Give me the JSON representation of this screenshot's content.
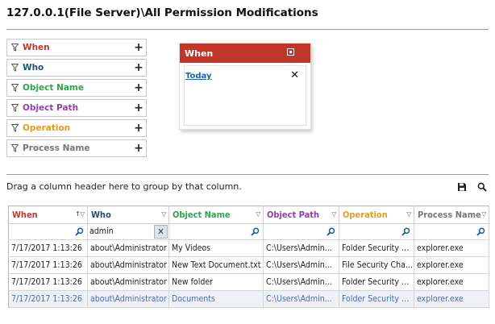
{
  "title": "127.0.0.1(File Server)\\All Permission Modifications",
  "filters": [
    {
      "label": "When",
      "color": "#c0372a"
    },
    {
      "label": "Who",
      "color": "#1f4e79"
    },
    {
      "label": "Object Name",
      "color": "#2ea44f"
    },
    {
      "label": "Object Path",
      "color": "#8e3fa8"
    },
    {
      "label": "Operation",
      "color": "#e39b1b"
    },
    {
      "label": "Process Name",
      "color": "#777777"
    }
  ],
  "panel": {
    "title": "When",
    "item": "Today"
  },
  "drag_hint": "Drag a column header here to group by that column.",
  "grid": {
    "columns": [
      {
        "label": "When",
        "color": "#c0372a"
      },
      {
        "label": "Who",
        "color": "#1f4e79"
      },
      {
        "label": "Object Name",
        "color": "#2ea44f"
      },
      {
        "label": "Object Path",
        "color": "#8e3fa8"
      },
      {
        "label": "Operation",
        "color": "#e39b1b"
      },
      {
        "label": "Process Name",
        "color": "#777777"
      }
    ],
    "filter_who": "admin",
    "rows": [
      [
        "7/17/2017 1:13:26",
        "about\\Administrator",
        "My Videos",
        "C:\\Users\\Admin...",
        "Folder Security C...",
        "explorer.exe"
      ],
      [
        "7/17/2017 1:13:26",
        "about\\Administrator",
        "New Text Document.txt",
        "C:\\Users\\Admin...",
        "File Security Cha...",
        "explorer.exe"
      ],
      [
        "7/17/2017 1:13:26",
        "about\\Administrator",
        "New folder",
        "C:\\Users\\Admin...",
        "Folder Security C...",
        "explorer.exe"
      ],
      [
        "7/17/2017 1:13:26",
        "about\\Administrator",
        "Documents",
        "C:\\Users\\Admin...",
        "Folder Security C...",
        "explorer.exe"
      ]
    ]
  }
}
